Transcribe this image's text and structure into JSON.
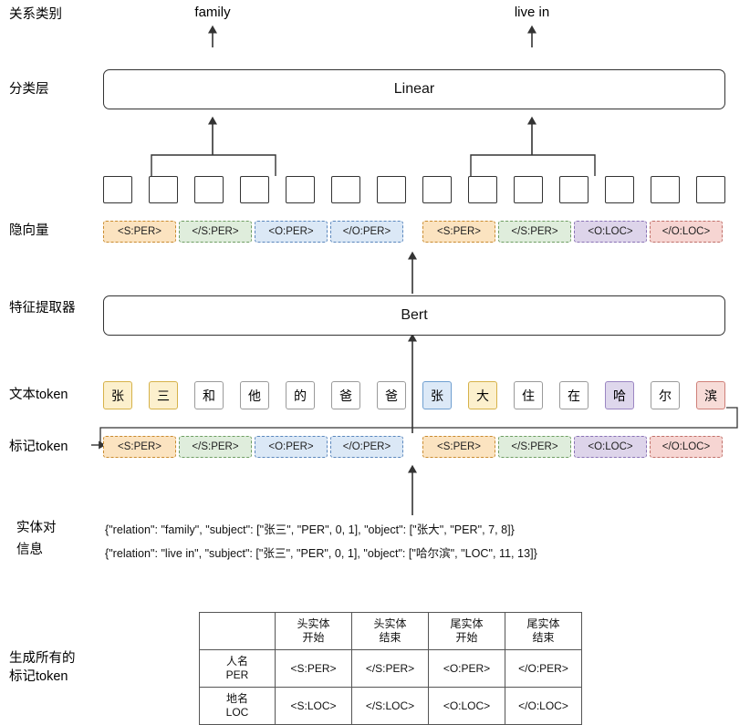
{
  "row_labels": {
    "relation_type": "关系类别",
    "classifier": "分类层",
    "hidden_vector": "隐向量",
    "feature_extractor": "特征提取器",
    "text_token": "文本token",
    "marker_token": "标记token",
    "entity_pair_line1": "实体对",
    "entity_pair_line2": "信息",
    "generate_line1": "生成所有的",
    "generate_line2": "标记token"
  },
  "outputs": {
    "left": "family",
    "right": "live in"
  },
  "boxes": {
    "linear": "Linear",
    "bert": "Bert"
  },
  "hidden_squares_count": 14,
  "marker_row_top": [
    "<S:PER>",
    "</S:PER>",
    "<O:PER>",
    "</O:PER>",
    "<S:PER>",
    "</S:PER>",
    "<O:LOC>",
    "</O:LOC>"
  ],
  "marker_row_bottom": [
    "<S:PER>",
    "</S:PER>",
    "<O:PER>",
    "</O:PER>",
    "<S:PER>",
    "</S:PER>",
    "<O:LOC>",
    "</O:LOC>"
  ],
  "text_tokens": [
    "张",
    "三",
    "和",
    "他",
    "的",
    "爸",
    "爸",
    "张",
    "大",
    "住",
    "在",
    "哈",
    "尔",
    "滨"
  ],
  "text_token_styles": [
    "y",
    "y",
    "n",
    "n",
    "n",
    "n",
    "n",
    "b",
    "y",
    "n",
    "n",
    "p",
    "n",
    "r"
  ],
  "entity_pair_info": [
    "{\"relation\": \"family\", \"subject\": [\"张三\", \"PER\", 0, 1], \"object\": [\"张大\", \"PER\", 7, 8]}",
    "{\"relation\": \"live in\", \"subject\": [\"张三\", \"PER\", 0, 1], \"object\": [\"哈尔滨\", \"LOC\", 11, 13]}"
  ],
  "table": {
    "headers": [
      "",
      "头实体\n开始",
      "头实体\n结束",
      "尾实体\n开始",
      "尾实体\n结束"
    ],
    "header_cells": [
      {
        "line1": "",
        "line2": ""
      },
      {
        "line1": "头实体",
        "line2": "开始"
      },
      {
        "line1": "头实体",
        "line2": "结束"
      },
      {
        "line1": "尾实体",
        "line2": "开始"
      },
      {
        "line1": "尾实体",
        "line2": "结束"
      }
    ],
    "rows": [
      {
        "label_line1": "人名",
        "label_line2": "PER",
        "cells": [
          "<S:PER>",
          "</S:PER>",
          "<O:PER>",
          "</O:PER>"
        ]
      },
      {
        "label_line1": "地名",
        "label_line2": "LOC",
        "cells": [
          "<S:LOC>",
          "</S:LOC>",
          "<O:LOC>",
          "</O:LOC>"
        ]
      }
    ]
  },
  "colors": {
    "sper_bg": "#fbe3c0",
    "esper_bg": "#dfeddc",
    "oper_bg": "#dbe8f6",
    "oloc_bg": "#ddd4ea",
    "eoloc_bg": "#f6d5d2",
    "stroke": "#333333"
  }
}
